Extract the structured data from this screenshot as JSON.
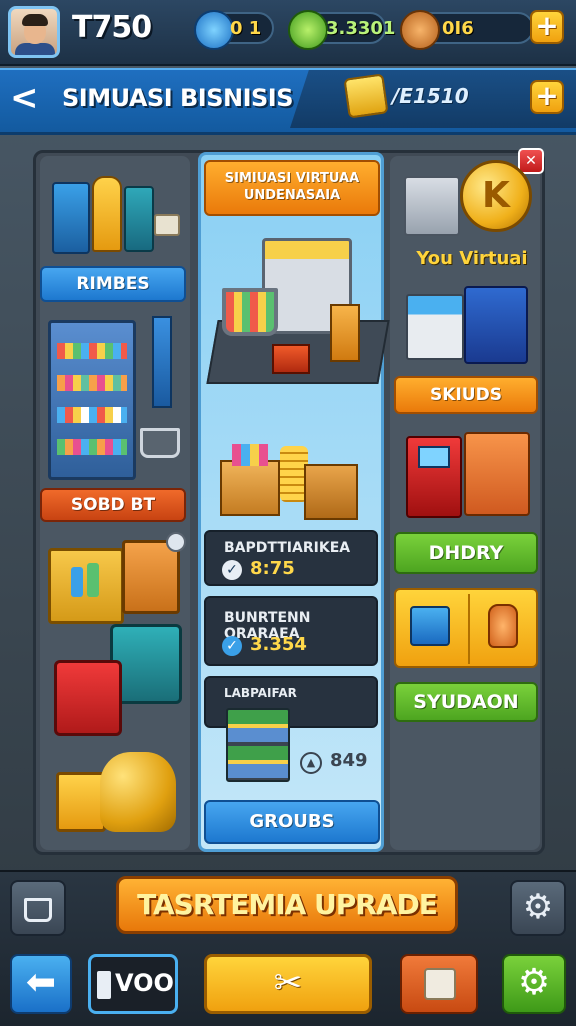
{
  "topbar": {
    "level": "T750",
    "resources": [
      {
        "icon": "blue-gem-icon",
        "value": "0 1"
      },
      {
        "icon": "green-cash-icon",
        "value": "3.3301"
      },
      {
        "icon": "food-bag-icon",
        "value": "0I6"
      }
    ],
    "plus_label": "+"
  },
  "header": {
    "back_label": "<",
    "title": "SIMUASI BISNISIS",
    "currency_value": "/E1510",
    "plus_label": "+"
  },
  "left_column": {
    "buttons": [
      "RIMBES",
      "SOBD BT"
    ]
  },
  "center_column": {
    "banner": "SIMIUASI VIRTUAA\nUNDENASAIA",
    "cards": [
      {
        "label": "BAPDTTIARIKEA",
        "value": "8:75"
      },
      {
        "label": "BUNRTENN ORARAEA",
        "value": "3.354"
      },
      {
        "label": "LABPAIFAR",
        "value": ""
      }
    ],
    "small_stat": "849",
    "bottom_button": "GROUBS"
  },
  "right_column": {
    "close_label": "✕",
    "coin_letter": "K",
    "coin_caption": "You Virtuai",
    "buttons": [
      "SKIUDS",
      "DHDRY",
      "SYUDAON"
    ]
  },
  "upgrade": {
    "label": "TASRTEMIA UPRADE"
  },
  "bottom_nav": {
    "counter": "VOO"
  },
  "colors": {
    "header_blue": "#1f6fc0",
    "upgrade_orange": "#f08a12",
    "accent_yellow": "#ffd43b",
    "green": "#5bb52a"
  }
}
